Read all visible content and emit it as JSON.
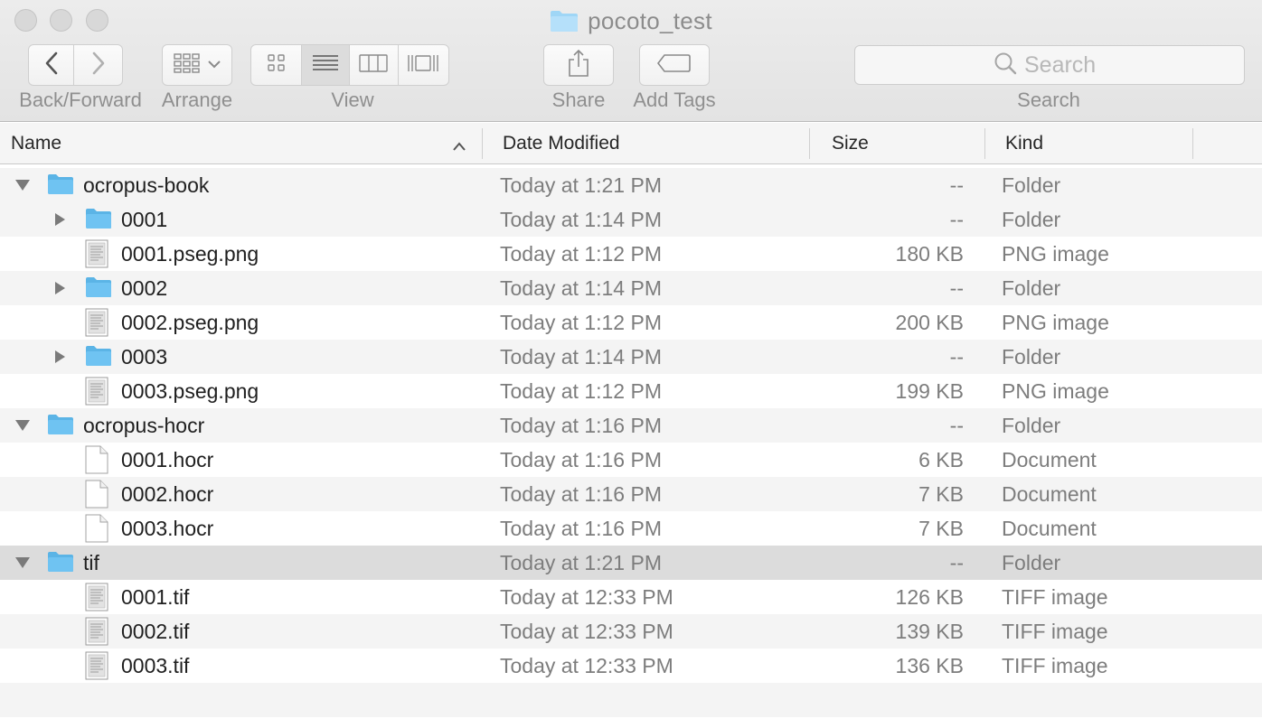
{
  "window": {
    "title": "pocoto_test"
  },
  "toolbar": {
    "back_forward_label": "Back/Forward",
    "arrange_label": "Arrange",
    "view_label": "View",
    "share_label": "Share",
    "add_tags_label": "Add Tags",
    "search_label": "Search",
    "search_placeholder": "Search"
  },
  "columns": {
    "name": "Name",
    "date_modified": "Date Modified",
    "size": "Size",
    "kind": "Kind"
  },
  "rows": [
    {
      "name": "ocropus-book",
      "date": "Today at 1:21 PM",
      "size": "--",
      "kind": "Folder",
      "icon": "folder-icon",
      "level": 0,
      "disclosure": "expanded"
    },
    {
      "name": "0001",
      "date": "Today at 1:14 PM",
      "size": "--",
      "kind": "Folder",
      "icon": "folder-icon",
      "level": 1,
      "disclosure": "collapsed"
    },
    {
      "name": "0001.pseg.png",
      "date": "Today at 1:12 PM",
      "size": "180 KB",
      "kind": "PNG image",
      "icon": "image-file-icon",
      "level": 1,
      "disclosure": "none"
    },
    {
      "name": "0002",
      "date": "Today at 1:14 PM",
      "size": "--",
      "kind": "Folder",
      "icon": "folder-icon",
      "level": 1,
      "disclosure": "collapsed"
    },
    {
      "name": "0002.pseg.png",
      "date": "Today at 1:12 PM",
      "size": "200 KB",
      "kind": "PNG image",
      "icon": "image-file-icon",
      "level": 1,
      "disclosure": "none"
    },
    {
      "name": "0003",
      "date": "Today at 1:14 PM",
      "size": "--",
      "kind": "Folder",
      "icon": "folder-icon",
      "level": 1,
      "disclosure": "collapsed"
    },
    {
      "name": "0003.pseg.png",
      "date": "Today at 1:12 PM",
      "size": "199 KB",
      "kind": "PNG image",
      "icon": "image-file-icon",
      "level": 1,
      "disclosure": "none"
    },
    {
      "name": "ocropus-hocr",
      "date": "Today at 1:16 PM",
      "size": "--",
      "kind": "Folder",
      "icon": "folder-icon",
      "level": 0,
      "disclosure": "expanded"
    },
    {
      "name": "0001.hocr",
      "date": "Today at 1:16 PM",
      "size": "6 KB",
      "kind": "Document",
      "icon": "document-icon",
      "level": 1,
      "disclosure": "none"
    },
    {
      "name": "0002.hocr",
      "date": "Today at 1:16 PM",
      "size": "7 KB",
      "kind": "Document",
      "icon": "document-icon",
      "level": 1,
      "disclosure": "none"
    },
    {
      "name": "0003.hocr",
      "date": "Today at 1:16 PM",
      "size": "7 KB",
      "kind": "Document",
      "icon": "document-icon",
      "level": 1,
      "disclosure": "none"
    },
    {
      "name": "tif",
      "date": "Today at 1:21 PM",
      "size": "--",
      "kind": "Folder",
      "icon": "folder-icon",
      "level": 0,
      "disclosure": "expanded",
      "selected": true
    },
    {
      "name": "0001.tif",
      "date": "Today at 12:33 PM",
      "size": "126 KB",
      "kind": "TIFF image",
      "icon": "image-file-icon",
      "level": 1,
      "disclosure": "none"
    },
    {
      "name": "0002.tif",
      "date": "Today at 12:33 PM",
      "size": "139 KB",
      "kind": "TIFF image",
      "icon": "image-file-icon",
      "level": 1,
      "disclosure": "none"
    },
    {
      "name": "0003.tif",
      "date": "Today at 12:33 PM",
      "size": "136 KB",
      "kind": "TIFF image",
      "icon": "image-file-icon",
      "level": 1,
      "disclosure": "none"
    }
  ],
  "colors": {
    "folder": "#6fc3f2",
    "folder_tab": "#5bb4e6",
    "selected_row": "#dcdcdc",
    "alt_row": "#f4f4f4"
  }
}
